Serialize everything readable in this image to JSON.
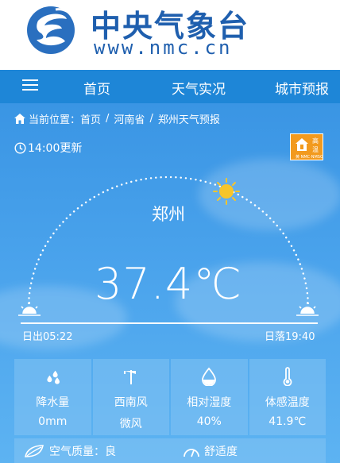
{
  "header": {
    "brand_cn": "中央气象台",
    "brand_url": "www.nmc.cn",
    "logo_icon": "nmc-logo-icon"
  },
  "nav": {
    "menu_icon": "hamburger-menu-icon",
    "items": [
      {
        "label": "首页"
      },
      {
        "label": "天气实况"
      },
      {
        "label": "城市预报"
      }
    ]
  },
  "breadcrumb": {
    "prefix": "当前位置：",
    "items": [
      "首页",
      "河南省",
      "郑州天气预报"
    ],
    "separator": "/"
  },
  "update_time": "14:00更新",
  "warning_badge": {
    "text": "高温",
    "small_text": "黄 NMC·NMSG",
    "color": "#f29a1e"
  },
  "weather": {
    "city": "郑州",
    "temperature": "37.4℃",
    "sunrise": "日出05:22",
    "sunset": "日落19:40"
  },
  "cards": [
    {
      "icon": "raindrops-icon",
      "label": "降水量",
      "value": "0mm"
    },
    {
      "icon": "wind-vane-icon",
      "label": "西南风",
      "value": "微风"
    },
    {
      "icon": "humidity-drop-icon",
      "label": "相对湿度",
      "value": "40%"
    },
    {
      "icon": "thermometer-icon",
      "label": "体感温度",
      "value": "41.9℃"
    }
  ],
  "bottom": {
    "air_quality_label": "空气质量：",
    "air_quality_value": "良",
    "comfort_label": "舒适度"
  },
  "colors": {
    "nav": "#1e86d7",
    "brand": "#1f5fae",
    "sun": "#f7c52a"
  }
}
